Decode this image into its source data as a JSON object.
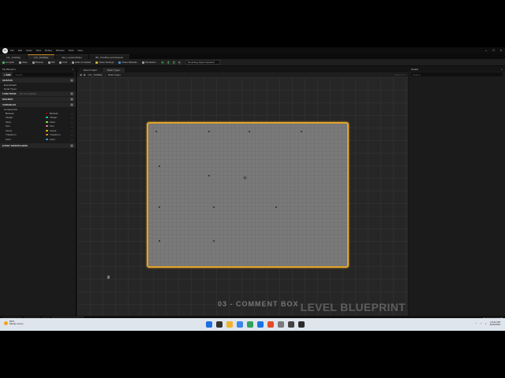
{
  "menu": {
    "items": [
      "File",
      "Edit",
      "Asset",
      "View",
      "Debug",
      "Window",
      "Tools",
      "Help"
    ]
  },
  "tabs": [
    {
      "label": "LVL_TestMap",
      "active": false
    },
    {
      "label": "LVL_TestMap",
      "active": true
    },
    {
      "label": "SM_LocationPicker",
      "active": false
    },
    {
      "label": "BP_ThirdPersonCharacter",
      "active": false
    }
  ],
  "toolbar": {
    "buttons": [
      "Compile",
      "Save",
      "Browse",
      "Diff",
      "Find",
      "Hide Unrelated",
      "Class Settings",
      "Class Defaults",
      "Simulation"
    ],
    "debug_filter": "No debug object selected"
  },
  "my_blueprint": {
    "title": "My Blueprint",
    "add_label": "+ Add",
    "search_placeholder": "Search",
    "graphs_label": "GRAPHS",
    "graph_items": [
      "EventGraph",
      "Node Types"
    ],
    "functions_label": "FUNCTIONS",
    "functions_note": "(50 Overridable)",
    "macros_label": "MACROS",
    "variables_label": "VARIABLES",
    "components_label": "Components",
    "variables": [
      {
        "name": "Boolean",
        "type": "Boolean",
        "color": "#8c0000"
      },
      {
        "name": "Integer",
        "type": "Integer",
        "color": "#1fe0a8"
      },
      {
        "name": "Float",
        "type": "Float",
        "color": "#9bf24a"
      },
      {
        "name": "Text",
        "type": "Text",
        "color": "#df7f9f"
      },
      {
        "name": "Vector",
        "type": "Vector",
        "color": "#f5c918"
      },
      {
        "name": "Transform",
        "type": "Transform",
        "color": "#f09030"
      },
      {
        "name": "Actor",
        "type": "Actor",
        "color": "#3aa3f0"
      }
    ],
    "dispatchers_label": "EVENT DISPATCHERS"
  },
  "graph": {
    "tabs": [
      "Event Graph",
      "Node Types"
    ],
    "breadcrumb_root": "LVL_TestMap",
    "breadcrumb_leaf": "Node Types",
    "zoom": "Zoom 1:1",
    "ghost_text": "03 - COMMENT BOX",
    "watermark": "LEVEL BLUEPRINT"
  },
  "details": {
    "title": "Details",
    "search_placeholder": "Search"
  },
  "statusbar": {
    "items": [
      "Content Drawer",
      "Output Log",
      "Cmd"
    ],
    "cmd_placeholder": "Enter Console Command",
    "source_control": "Source Control Off"
  },
  "taskbar": {
    "temperature": "59°F",
    "weather": "Mostly sunny",
    "time": "10:41 PM",
    "date": "3/26/2023",
    "app_colors": [
      "#1d6fe0",
      "#333333",
      "#f0b429",
      "#3a86e8",
      "#2fa35e",
      "#1a73e8",
      "#e44d26",
      "#7a7a7a",
      "#444444",
      "#2b2b2b"
    ]
  }
}
